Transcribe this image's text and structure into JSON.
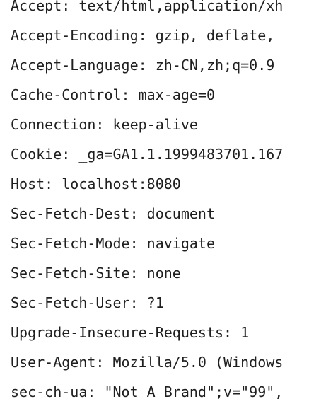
{
  "headers": [
    "Accept: text/html,application/xh",
    "Accept-Encoding: gzip, deflate,",
    "Accept-Language: zh-CN,zh;q=0.9",
    "Cache-Control: max-age=0",
    "Connection: keep-alive",
    "Cookie: _ga=GA1.1.1999483701.167",
    "Host: localhost:8080",
    "Sec-Fetch-Dest: document",
    "Sec-Fetch-Mode: navigate",
    "Sec-Fetch-Site: none",
    "Sec-Fetch-User: ?1",
    "Upgrade-Insecure-Requests: 1",
    "User-Agent: Mozilla/5.0 (Windows",
    "sec-ch-ua: \"Not_A Brand\";v=\"99\","
  ]
}
